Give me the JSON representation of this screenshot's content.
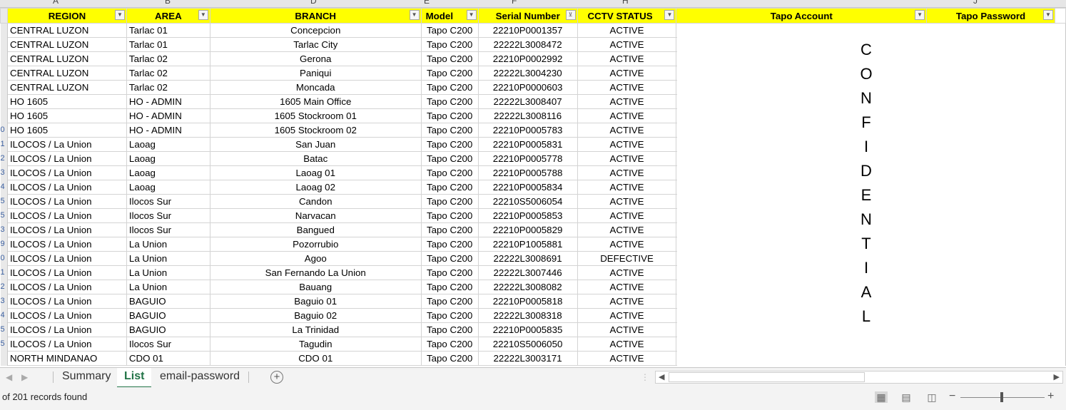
{
  "column_letters": [
    "A",
    "B",
    "D",
    "E",
    "F",
    "H",
    "J"
  ],
  "headers": {
    "region": "REGION",
    "area": "AREA",
    "branch": "BRANCH",
    "model": "Model",
    "serial": "Serial Number",
    "cctv": "CCTV STATUS",
    "tapo_account": "Tapo Account",
    "tapo_password": "Tapo Password"
  },
  "row_numbers": [
    "",
    "",
    "",
    "",
    "",
    "",
    "",
    "0",
    "1",
    "2",
    "3",
    "4",
    "5",
    "5",
    "3",
    "9",
    "0",
    "1",
    "2",
    "3",
    "4",
    "5",
    "5",
    ""
  ],
  "rows": [
    {
      "region": "CENTRAL LUZON",
      "area": "Tarlac 01",
      "branch": "Concepcion",
      "model": "Tapo C200",
      "serial": "22210P0001357",
      "status": "ACTIVE"
    },
    {
      "region": "CENTRAL LUZON",
      "area": "Tarlac 01",
      "branch": "Tarlac City",
      "model": "Tapo C200",
      "serial": "22222L3008472",
      "status": "ACTIVE"
    },
    {
      "region": "CENTRAL LUZON",
      "area": "Tarlac 02",
      "branch": "Gerona",
      "model": "Tapo C200",
      "serial": "22210P0002992",
      "status": "ACTIVE"
    },
    {
      "region": "CENTRAL LUZON",
      "area": "Tarlac 02",
      "branch": "Paniqui",
      "model": "Tapo C200",
      "serial": "22222L3004230",
      "status": "ACTIVE"
    },
    {
      "region": "CENTRAL LUZON",
      "area": "Tarlac 02",
      "branch": "Moncada",
      "model": "Tapo C200",
      "serial": "22210P0000603",
      "status": "ACTIVE"
    },
    {
      "region": "HO 1605",
      "area": "HO - ADMIN",
      "branch": "1605 Main Office",
      "model": "Tapo C200",
      "serial": "22222L3008407",
      "status": "ACTIVE"
    },
    {
      "region": "HO 1605",
      "area": "HO - ADMIN",
      "branch": "1605 Stockroom 01",
      "model": "Tapo C200",
      "serial": "22222L3008116",
      "status": "ACTIVE"
    },
    {
      "region": "HO 1605",
      "area": "HO - ADMIN",
      "branch": "1605 Stockroom 02",
      "model": "Tapo C200",
      "serial": "22210P0005783",
      "status": "ACTIVE"
    },
    {
      "region": "ILOCOS / La Union",
      "area": "Laoag",
      "branch": "San Juan",
      "model": "Tapo C200",
      "serial": "22210P0005831",
      "status": "ACTIVE"
    },
    {
      "region": "ILOCOS / La Union",
      "area": "Laoag",
      "branch": "Batac",
      "model": "Tapo C200",
      "serial": "22210P0005778",
      "status": "ACTIVE"
    },
    {
      "region": "ILOCOS / La Union",
      "area": "Laoag",
      "branch": "Laoag 01",
      "model": "Tapo C200",
      "serial": "22210P0005788",
      "status": "ACTIVE"
    },
    {
      "region": "ILOCOS / La Union",
      "area": "Laoag",
      "branch": "Laoag 02",
      "model": "Tapo C200",
      "serial": "22210P0005834",
      "status": "ACTIVE"
    },
    {
      "region": "ILOCOS / La Union",
      "area": "Ilocos Sur",
      "branch": "Candon",
      "model": "Tapo C200",
      "serial": "22210S5006054",
      "status": "ACTIVE"
    },
    {
      "region": "ILOCOS / La Union",
      "area": "Ilocos Sur",
      "branch": "Narvacan",
      "model": "Tapo C200",
      "serial": "22210P0005853",
      "status": "ACTIVE"
    },
    {
      "region": "ILOCOS / La Union",
      "area": "Ilocos Sur",
      "branch": "Bangued",
      "model": "Tapo C200",
      "serial": "22210P0005829",
      "status": "ACTIVE"
    },
    {
      "region": "ILOCOS / La Union",
      "area": "La Union",
      "branch": "Pozorrubio",
      "model": "Tapo C200",
      "serial": "22210P1005881",
      "status": "ACTIVE"
    },
    {
      "region": "ILOCOS / La Union",
      "area": "La Union",
      "branch": "Agoo",
      "model": "Tapo C200",
      "serial": "22222L3008691",
      "status": "DEFECTIVE"
    },
    {
      "region": "ILOCOS / La Union",
      "area": "La Union",
      "branch": "San Fernando La Union",
      "model": "Tapo C200",
      "serial": "22222L3007446",
      "status": "ACTIVE"
    },
    {
      "region": "ILOCOS / La Union",
      "area": "La Union",
      "branch": "Bauang",
      "model": "Tapo C200",
      "serial": "22222L3008082",
      "status": "ACTIVE"
    },
    {
      "region": "ILOCOS / La Union",
      "area": "BAGUIO",
      "branch": "Baguio 01",
      "model": "Tapo C200",
      "serial": "22210P0005818",
      "status": "ACTIVE"
    },
    {
      "region": "ILOCOS / La Union",
      "area": "BAGUIO",
      "branch": "Baguio 02",
      "model": "Tapo C200",
      "serial": "22222L3008318",
      "status": "ACTIVE"
    },
    {
      "region": "ILOCOS / La Union",
      "area": "BAGUIO",
      "branch": "La Trinidad",
      "model": "Tapo C200",
      "serial": "22210P0005835",
      "status": "ACTIVE"
    },
    {
      "region": "ILOCOS / La Union",
      "area": "Ilocos Sur",
      "branch": "Tagudin",
      "model": "Tapo C200",
      "serial": "22210S5006050",
      "status": "ACTIVE"
    },
    {
      "region": "NORTH MINDANAO",
      "area": "CDO 01",
      "branch": "CDO 01",
      "model": "Tapo C200",
      "serial": "22222L3003171",
      "status": "ACTIVE"
    }
  ],
  "confidential_letters": [
    "C",
    "O",
    "N",
    "F",
    "I",
    "D",
    "E",
    "N",
    "T",
    "I",
    "A",
    "L"
  ],
  "sheet_tabs": [
    {
      "label": "Summary",
      "active": false
    },
    {
      "label": "List",
      "active": true
    },
    {
      "label": "email-password",
      "active": false
    }
  ],
  "status_text": "of 201 records found",
  "icons": {
    "filter": "dropdown-arrow",
    "filter_active": "funnel",
    "add_sheet": "plus-circle",
    "view_normal": "grid",
    "view_page_layout": "page",
    "view_page_break": "page-break"
  }
}
